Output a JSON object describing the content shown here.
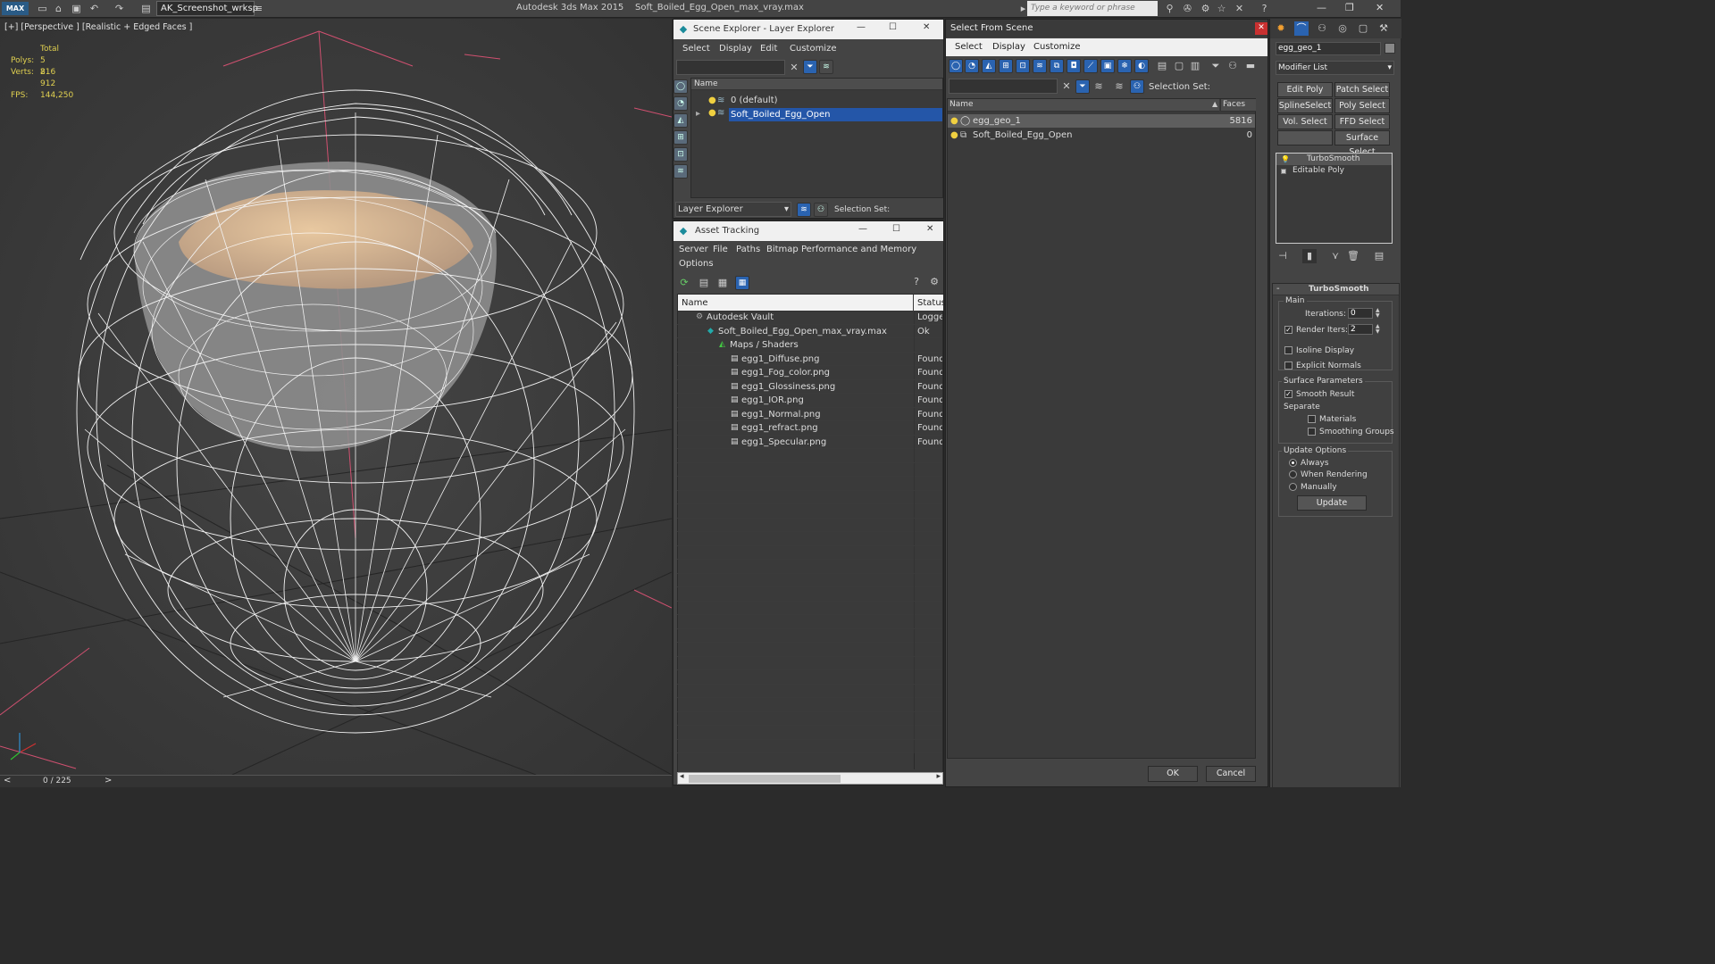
{
  "app": {
    "title": "Autodesk 3ds Max  2015",
    "filename": "Soft_Boiled_Egg_Open_max_vray.max",
    "workspace": "AK_Screenshot_wrksp",
    "search_placeholder": "Type a keyword or phrase",
    "logo": "MAX"
  },
  "viewport": {
    "label": "[+] [Perspective ] [Realistic + Edged Faces ]",
    "stats": {
      "total_label": "Total",
      "polys_label": "Polys:",
      "polys_value": "5 816",
      "verts_label": "Verts:",
      "verts_value": "2 912",
      "fps_label": "FPS:",
      "fps_value": "144,250"
    }
  },
  "timeline": {
    "position": "0 / 225",
    "prev": "<",
    "next": ">"
  },
  "scene_explorer": {
    "title": "Scene Explorer - Layer Explorer",
    "menus": [
      "Select",
      "Display",
      "Edit",
      "Customize"
    ],
    "column_name": "Name",
    "rows": [
      {
        "label": "0 (default)",
        "selected": false
      },
      {
        "label": "Soft_Boiled_Egg_Open",
        "selected": true
      }
    ],
    "footer_dropdown": "Layer Explorer",
    "selection_set_label": "Selection Set:"
  },
  "asset_tracking": {
    "title": "Asset Tracking",
    "menus": [
      "Server",
      "File",
      "Paths",
      "Bitmap Performance and Memory"
    ],
    "menu2": "Options",
    "columns": {
      "name": "Name",
      "status": "Status"
    },
    "rows": [
      {
        "name": "Autodesk Vault",
        "status": "Logged",
        "indent": 1
      },
      {
        "name": "Soft_Boiled_Egg_Open_max_vray.max",
        "status": "Ok",
        "indent": 2
      },
      {
        "name": "Maps / Shaders",
        "status": "",
        "indent": 3
      },
      {
        "name": "egg1_Diffuse.png",
        "status": "Found",
        "indent": 4
      },
      {
        "name": "egg1_Fog_color.png",
        "status": "Found",
        "indent": 4
      },
      {
        "name": "egg1_Glossiness.png",
        "status": "Found",
        "indent": 4
      },
      {
        "name": "egg1_IOR.png",
        "status": "Found",
        "indent": 4
      },
      {
        "name": "egg1_Normal.png",
        "status": "Found",
        "indent": 4
      },
      {
        "name": "egg1_refract.png",
        "status": "Found",
        "indent": 4
      },
      {
        "name": "egg1_Specular.png",
        "status": "Found",
        "indent": 4
      }
    ]
  },
  "select_from_scene": {
    "title": "Select From Scene",
    "menus": [
      "Select",
      "Display",
      "Customize"
    ],
    "selection_set_label": "Selection Set:",
    "columns": {
      "name": "Name",
      "faces": "Faces"
    },
    "rows": [
      {
        "name": "egg_geo_1",
        "faces": "5816",
        "selected": true
      },
      {
        "name": "Soft_Boiled_Egg_Open",
        "faces": "0",
        "selected": false
      }
    ],
    "ok_label": "OK",
    "cancel_label": "Cancel"
  },
  "command_panel": {
    "object_name": "egg_geo_1",
    "modifier_list": "Modifier List",
    "buttons": [
      "Edit Poly",
      "Patch Select",
      "SplineSelect",
      "Poly Select",
      "Vol. Select",
      "FFD Select",
      "",
      "Surface Select"
    ],
    "stack": [
      "TurboSmooth",
      "Editable Poly"
    ],
    "rollout_title": "TurboSmooth",
    "main_label": "Main",
    "iterations_label": "Iterations:",
    "iterations_value": "0",
    "render_iters_label": "Render Iters:",
    "render_iters_value": "2",
    "isoline_label": "Isoline Display",
    "explicit_normals_label": "Explicit Normals",
    "surface_params_label": "Surface Parameters",
    "smooth_result_label": "Smooth Result",
    "separate_label": "Separate",
    "materials_label": "Materials",
    "smoothing_groups_label": "Smoothing Groups",
    "update_options_label": "Update Options",
    "always_label": "Always",
    "when_rendering_label": "When Rendering",
    "manually_label": "Manually",
    "update_button": "Update"
  }
}
